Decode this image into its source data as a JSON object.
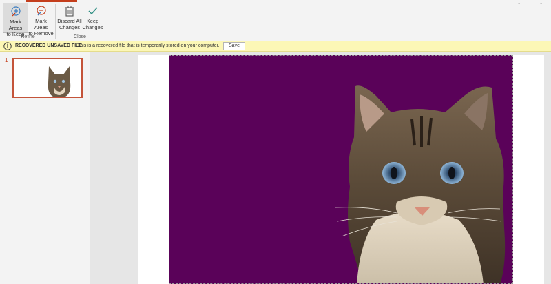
{
  "ribbon": {
    "groups": [
      {
        "label": "Refine",
        "buttons": [
          {
            "label": "Mark Areas\nto Keep",
            "icon": "pen-plus-icon",
            "active": true
          },
          {
            "label": "Mark Areas\nto Remove",
            "icon": "pen-minus-icon",
            "active": false
          }
        ]
      },
      {
        "label": "Close",
        "buttons": [
          {
            "label": "Discard All\nChanges",
            "icon": "trash-icon",
            "active": false
          },
          {
            "label": "Keep\nChanges",
            "icon": "checkmark-icon",
            "active": false
          }
        ]
      }
    ],
    "window_controls": "- -"
  },
  "infobar": {
    "icon": "info-icon",
    "title": "RECOVERED UNSAVED FILE",
    "message": "This is a recovered file that is temporarily stored on your computer.",
    "save_label": "Save"
  },
  "thumbnails": [
    {
      "number": "1",
      "selected": true
    }
  ],
  "slide": {
    "background_color": "#5a0259",
    "accent_color": "#c43e1c"
  }
}
